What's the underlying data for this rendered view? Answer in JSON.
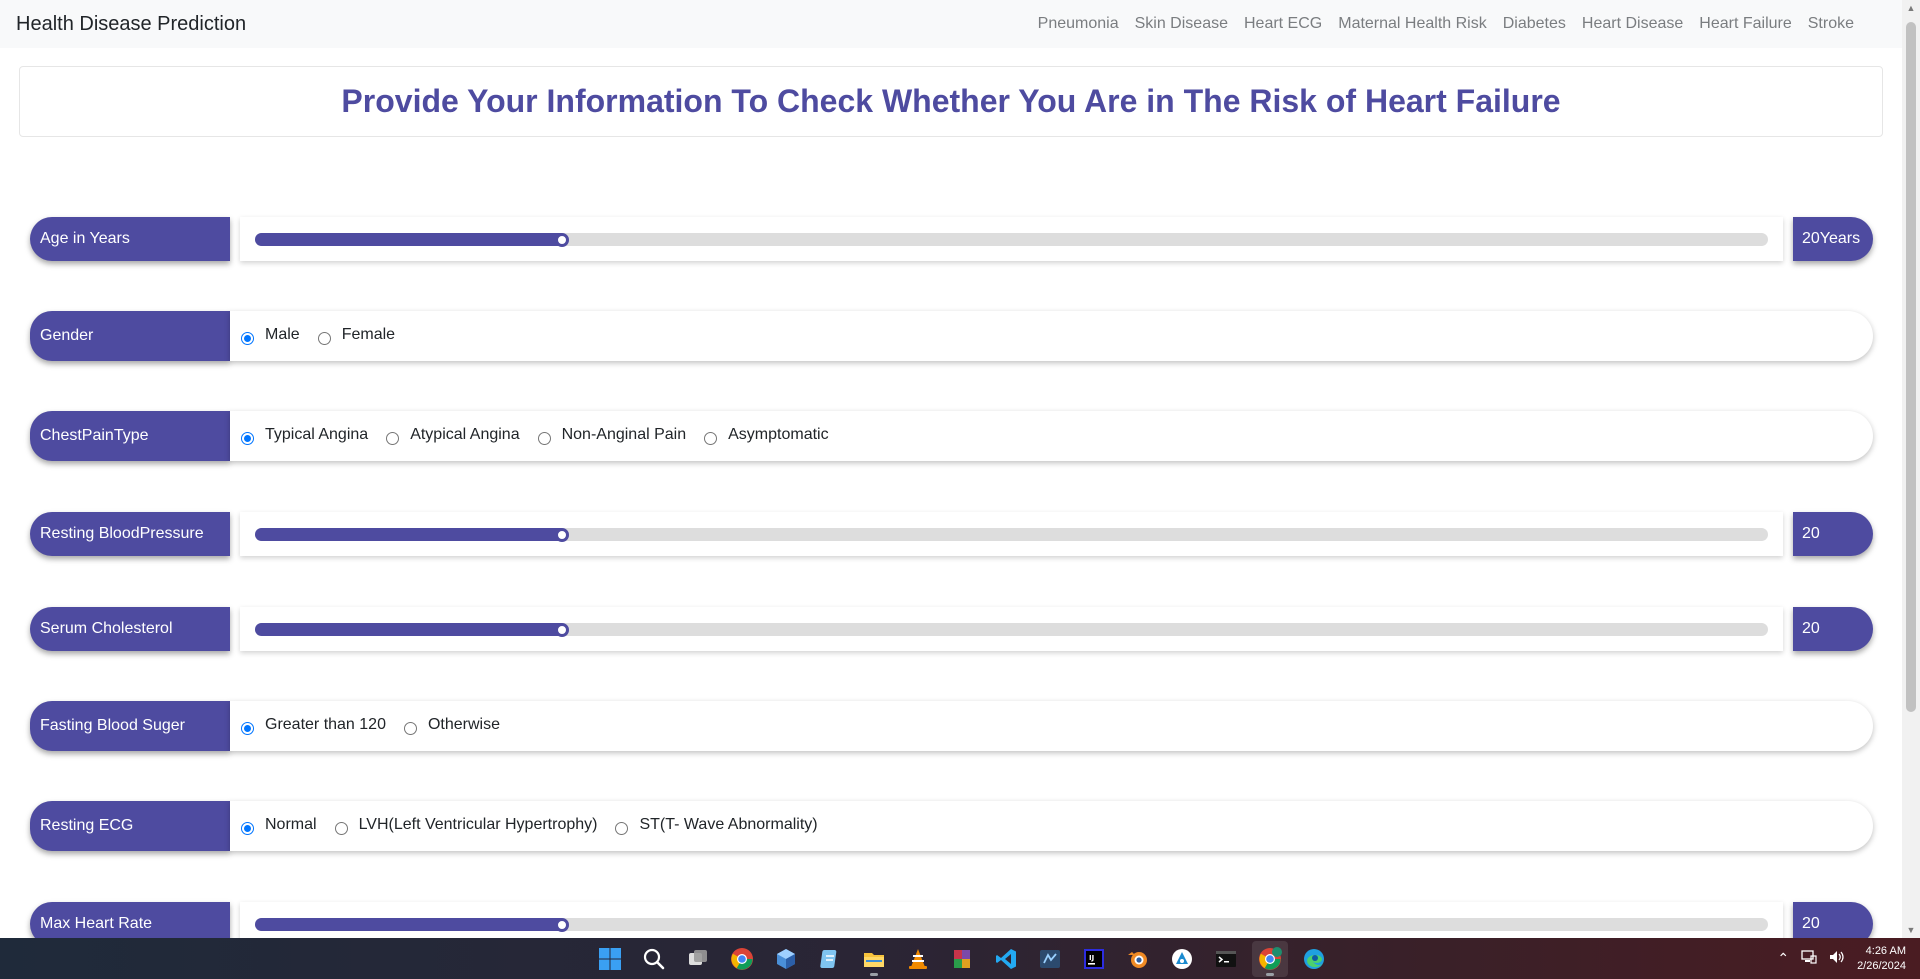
{
  "navbar": {
    "brand": "Health Disease Prediction",
    "links": [
      "Pneumonia",
      "Skin Disease",
      "Heart ECG",
      "Maternal Health Risk",
      "Diabetes",
      "Heart Disease",
      "Heart Failure",
      "Stroke"
    ]
  },
  "heading": "Provide Your Information To Check Whether You Are in The Risk of Heart Failure",
  "fields": {
    "age": {
      "label": "Age in Years",
      "value_text": "20Years",
      "fill_fraction": 0.203
    },
    "gender": {
      "label": "Gender",
      "options": [
        "Male",
        "Female"
      ],
      "selected": "Male"
    },
    "chest_pain": {
      "label": "ChestPainType",
      "options": [
        "Typical Angina",
        "Atypical Angina",
        "Non-Anginal Pain",
        "Asymptomatic"
      ],
      "selected": "Typical Angina"
    },
    "resting_bp": {
      "label": "Resting BloodPressure",
      "value_text": "20",
      "fill_fraction": 0.203
    },
    "cholesterol": {
      "label": "Serum Cholesterol",
      "value_text": "20",
      "fill_fraction": 0.203
    },
    "fasting_bs": {
      "label": "Fasting Blood Suger",
      "options": [
        "Greater than 120",
        "Otherwise"
      ],
      "selected": "Greater than 120"
    },
    "resting_ecg": {
      "label": "Resting ECG",
      "options": [
        "Normal",
        "LVH(Left Ventricular Hypertrophy)",
        "ST(T- Wave Abnormality)"
      ],
      "selected": "Normal"
    },
    "max_hr": {
      "label": "Max Heart Rate",
      "value_text": "20",
      "fill_fraction": 0.203
    }
  },
  "colors": {
    "accent": "#4e4ba0",
    "radio_checked": "#0075ff"
  },
  "taskbar": {
    "icons": [
      "windows-start-icon",
      "search-icon",
      "task-view-icon",
      "chrome-icon",
      "app-cube-icon",
      "notepad-icon",
      "file-explorer-icon",
      "vlc-icon",
      "winrar-icon",
      "vscode-icon",
      "terminal-app-icon",
      "jetbrains-icon",
      "blender-icon",
      "arduino-icon",
      "command-prompt-icon",
      "chrome-profile-icon",
      "edge-icon"
    ],
    "time": "4:26 AM",
    "date": "2/26/2024"
  }
}
